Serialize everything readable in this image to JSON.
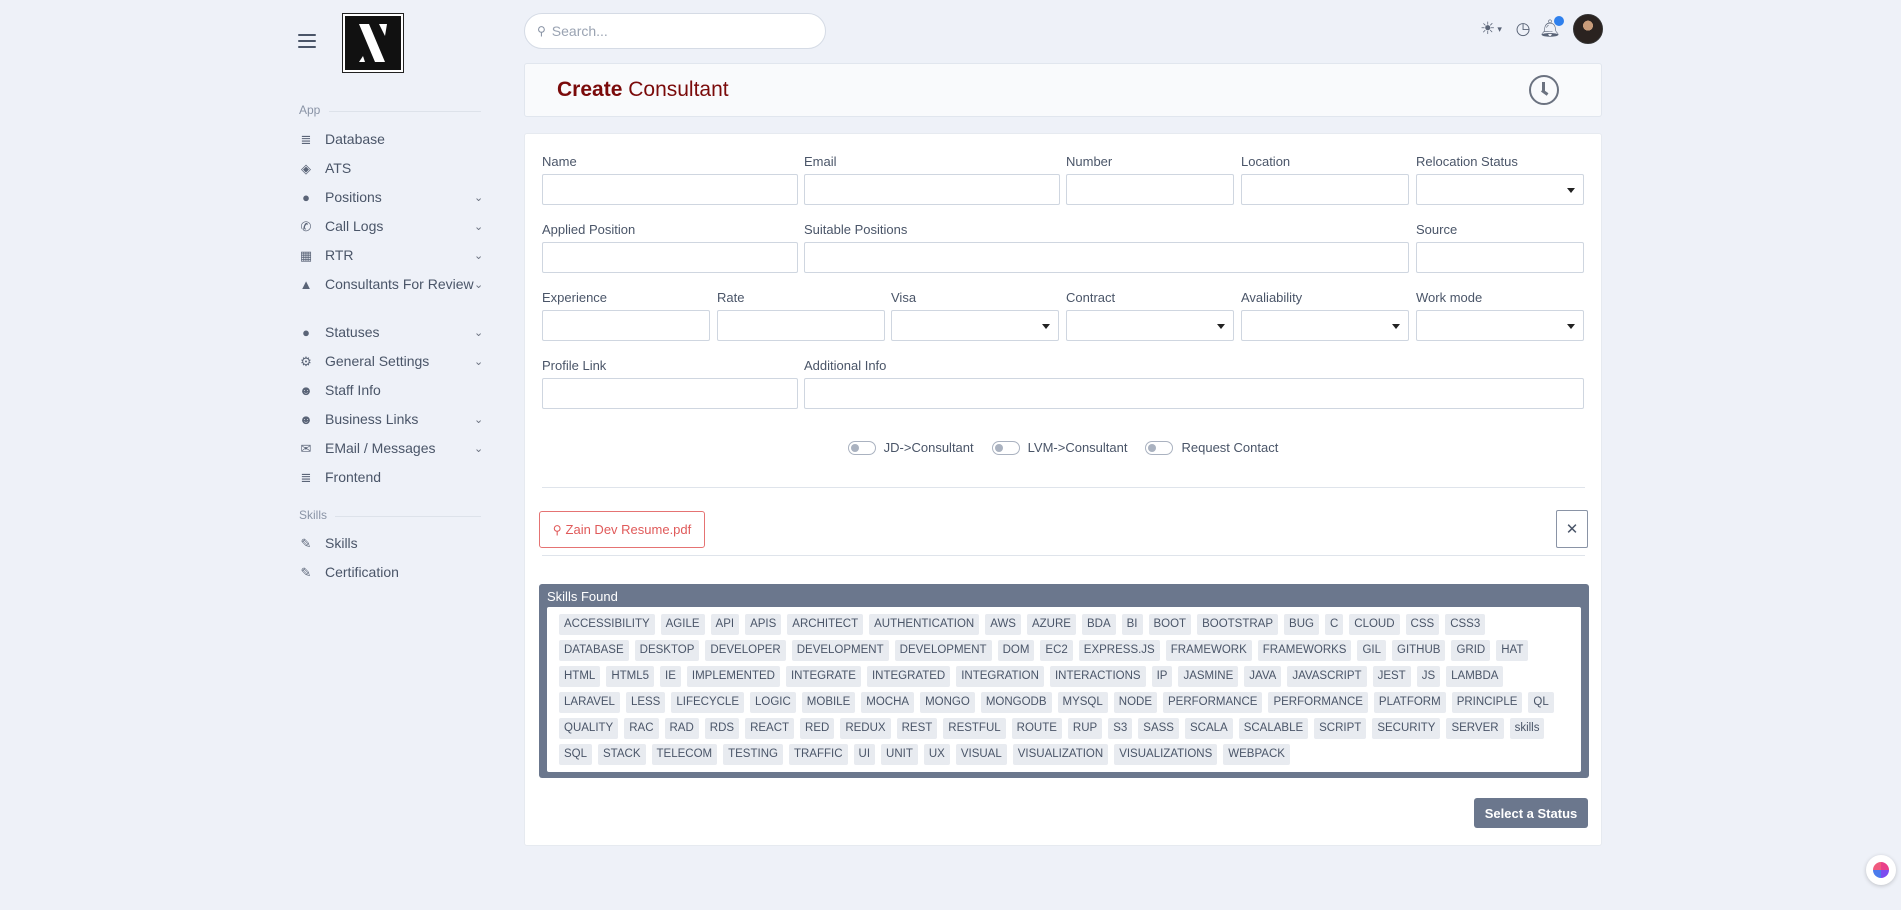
{
  "search": {
    "placeholder": "Search..."
  },
  "sidebar": {
    "sections": [
      {
        "label": "App"
      },
      {
        "label": "Skills"
      }
    ],
    "items": [
      {
        "label": "Database",
        "icon": "database-icon",
        "has_children": false
      },
      {
        "label": "ATS",
        "icon": "layers-icon",
        "has_children": false
      },
      {
        "label": "Positions",
        "icon": "user-icon",
        "has_children": true
      },
      {
        "label": "Call Logs",
        "icon": "phone-icon",
        "has_children": true
      },
      {
        "label": "RTR",
        "icon": "calendar-icon",
        "has_children": true
      },
      {
        "label": "Consultants For Review",
        "icon": "graduation-cap-icon",
        "has_children": true
      },
      {
        "label": "Statuses",
        "icon": "user-icon",
        "has_children": true
      },
      {
        "label": "General Settings",
        "icon": "gears-icon",
        "has_children": true
      },
      {
        "label": "Staff Info",
        "icon": "users-icon",
        "has_children": false
      },
      {
        "label": "Business Links",
        "icon": "users-icon",
        "has_children": true
      },
      {
        "label": "EMail / Messages",
        "icon": "mailbox-icon",
        "has_children": true
      },
      {
        "label": "Frontend",
        "icon": "database-icon",
        "has_children": false
      },
      {
        "label": "Skills",
        "icon": "wrench-icon",
        "has_children": false
      },
      {
        "label": "Certification",
        "icon": "wrench-icon",
        "has_children": false
      }
    ]
  },
  "header": {
    "title_bold": "Create",
    "title_rest": "Consultant"
  },
  "form": {
    "name_label": "Name",
    "email_label": "Email",
    "number_label": "Number",
    "location_label": "Location",
    "relocation_label": "Relocation Status",
    "applied_position_label": "Applied Position",
    "suitable_positions_label": "Suitable Positions",
    "source_label": "Source",
    "experience_label": "Experience",
    "rate_label": "Rate",
    "visa_label": "Visa",
    "contract_label": "Contract",
    "availability_label": "Avaliability",
    "work_mode_label": "Work mode",
    "profile_link_label": "Profile Link",
    "additional_info_label": "Additional Info"
  },
  "toggles": [
    {
      "label": "JD->Consultant",
      "on": false
    },
    {
      "label": "LVM->Consultant",
      "on": false
    },
    {
      "label": "Request Contact",
      "on": false
    }
  ],
  "attachment": {
    "filename": "Zain Dev Resume.pdf",
    "close_symbol": "✕"
  },
  "skills": {
    "heading": "Skills Found",
    "rows": [
      [
        "ACCESSIBILITY",
        "AGILE",
        "API",
        "APIS",
        "ARCHITECT",
        "AUTHENTICATION",
        "AWS",
        "AZURE",
        "BDA",
        "BI",
        "BOOT",
        "BOOTSTRAP",
        "BUG",
        "C",
        "CLOUD",
        "CSS",
        "CSS3"
      ],
      [
        "DATABASE",
        "DESKTOP",
        "DEVELOPER",
        "DEVELOPMENT",
        "DEVELOPMENT",
        "DOM",
        "EC2",
        "EXPRESS.JS",
        "FRAMEWORK",
        "FRAMEWORKS",
        "GIL",
        "GITHUB",
        "GRID",
        "HAT"
      ],
      [
        "HTML",
        "HTML5",
        "IE",
        "IMPLEMENTED",
        "INTEGRATE",
        "INTEGRATED",
        "INTEGRATION",
        "INTERACTIONS",
        "IP",
        "JASMINE",
        "JAVA",
        "JAVASCRIPT",
        "JEST",
        "JS",
        "LAMBDA"
      ],
      [
        "LARAVEL",
        "LESS",
        "LIFECYCLE",
        "LOGIC",
        "MOBILE",
        "MOCHA",
        "MONGO",
        "MONGODB",
        "MYSQL",
        "NODE",
        "PERFORMANCE",
        "PERFORMANCE",
        "PLATFORM",
        "PRINCIPLE",
        "QL"
      ],
      [
        "QUALITY",
        "RAC",
        "RAD",
        "RDS",
        "REACT",
        "RED",
        "REDUX",
        "REST",
        "RESTFUL",
        "ROUTE",
        "RUP",
        "S3",
        "SASS",
        "SCALA",
        "SCALABLE",
        "SCRIPT",
        "SECURITY",
        "SERVER",
        "skills"
      ],
      [
        "SQL",
        "STACK",
        "TELECOM",
        "TESTING",
        "TRAFFIC",
        "UI",
        "UNIT",
        "UX",
        "VISUAL",
        "VISUALIZATION",
        "VISUALIZATIONS",
        "WEBPACK"
      ]
    ]
  },
  "actions": {
    "status_button": "Select a Status"
  }
}
